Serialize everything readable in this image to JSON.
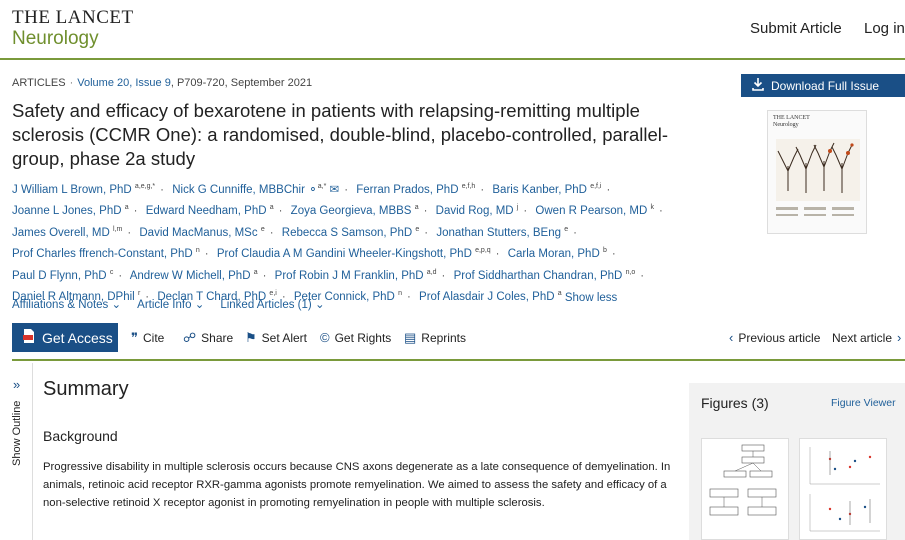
{
  "header": {
    "brand_line1": "THE LANCET",
    "brand_line2": "Neurology",
    "submit_article": "Submit Article",
    "log_in": "Log in"
  },
  "meta": {
    "type": "ARTICLES",
    "volume": "Volume 20, Issue 9",
    "pages": "P709-720, September 2021"
  },
  "title": "Safety and efficacy of bexarotene in patients with relapsing-remitting multiple sclerosis (CCMR One): a randomised, double-blind, placebo-controlled, parallel-group, phase 2a study",
  "download_label": "Download Full Issue",
  "cover": {
    "title_line1": "THE LANCET",
    "title_line2": "Neurology"
  },
  "authors": [
    {
      "name": "J William L Brown, PhD",
      "sup": "a,e,g,*"
    },
    {
      "name": "Nick G Cunniffe, MBBChir",
      "sup": "a,*"
    },
    {
      "name": "Ferran Prados, PhD",
      "sup": "e,f,h"
    },
    {
      "name": "Baris Kanber, PhD",
      "sup": "e,f,i"
    },
    {
      "name": "Joanne L Jones, PhD",
      "sup": "a"
    },
    {
      "name": "Edward Needham, PhD",
      "sup": "a"
    },
    {
      "name": "Zoya Georgieva, MBBS",
      "sup": "a"
    },
    {
      "name": "David Rog, MD",
      "sup": "j"
    },
    {
      "name": "Owen R Pearson, MD",
      "sup": "k"
    },
    {
      "name": "James Overell, MD",
      "sup": "l,m"
    },
    {
      "name": "David MacManus, MSc",
      "sup": "e"
    },
    {
      "name": "Rebecca S Samson, PhD",
      "sup": "e"
    },
    {
      "name": "Jonathan Stutters, BEng",
      "sup": "e"
    },
    {
      "name": "Prof Charles ffrench-Constant, PhD",
      "sup": "n"
    },
    {
      "name": "Prof Claudia A M Gandini Wheeler-Kingshott, PhD",
      "sup": "e,p,q"
    },
    {
      "name": "Carla Moran, PhD",
      "sup": "b"
    },
    {
      "name": "Paul D Flynn, PhD",
      "sup": "c"
    },
    {
      "name": "Andrew W Michell, PhD",
      "sup": "a"
    },
    {
      "name": "Prof Robin J M Franklin, PhD",
      "sup": "a,d"
    },
    {
      "name": "Prof Siddharthan Chandran, PhD",
      "sup": "n,o"
    },
    {
      "name": "Daniel R Altmann, DPhil",
      "sup": "r"
    },
    {
      "name": "Declan T Chard, PhD",
      "sup": "e,i"
    },
    {
      "name": "Peter Connick, PhD",
      "sup": "n"
    },
    {
      "name": "Prof Alasdair J Coles, PhD",
      "sup": "a"
    }
  ],
  "show_less": "Show less",
  "expanders": {
    "affiliations": "Affiliations & Notes",
    "article_info": "Article Info",
    "linked_articles": "Linked Articles (1)"
  },
  "toolbar": {
    "get_access": "Get Access",
    "cite": "Cite",
    "share": "Share",
    "set_alert": "Set Alert",
    "get_rights": "Get Rights",
    "reprints": "Reprints",
    "previous": "Previous article",
    "next": "Next article"
  },
  "outline_label": "Show Outline",
  "summary": {
    "heading": "Summary",
    "subheading": "Background",
    "text": "Progressive disability in multiple sclerosis occurs because CNS axons degenerate as a late consequence of demyelination. In animals, retinoic acid receptor RXR-gamma agonists promote remyelination. We aimed to assess the safety and efficacy of a non-selective retinoid X receptor agonist in promoting remyelination in people with multiple sclerosis."
  },
  "figures": {
    "title": "Figures (3)",
    "viewer": "Figure Viewer"
  },
  "colors": {
    "brand_green": "#6f8f2d",
    "link_blue": "#1f5f99",
    "button_blue": "#1a4f86",
    "rule_green": "#7a9a3b"
  }
}
